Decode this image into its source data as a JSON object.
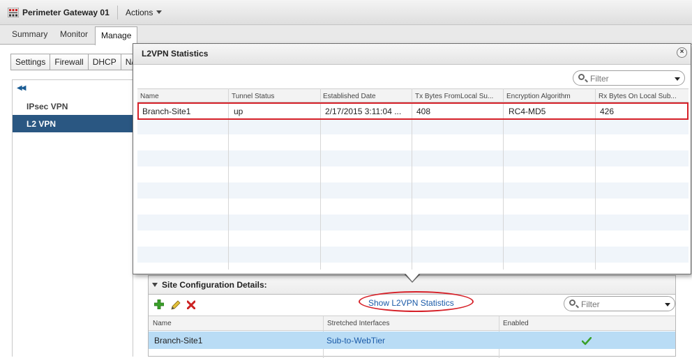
{
  "header": {
    "title": "Perimeter Gateway 01",
    "actions_label": "Actions"
  },
  "main_tabs": [
    {
      "label": "Summary"
    },
    {
      "label": "Monitor"
    },
    {
      "label": "Manage",
      "active": true
    }
  ],
  "sub_tabs": [
    {
      "label": "Settings"
    },
    {
      "label": "Firewall"
    },
    {
      "label": "DHCP"
    },
    {
      "label": "N/"
    }
  ],
  "left_nav": {
    "items": [
      {
        "label": "IPsec VPN",
        "selected": false
      },
      {
        "label": "L2 VPN",
        "selected": true
      }
    ]
  },
  "dialog": {
    "title": "L2VPN Statistics",
    "filter_placeholder": "Filter",
    "columns": [
      "Name",
      "Tunnel Status",
      "Established Date",
      "Tx Bytes FromLocal Su...",
      "Encryption Algorithm",
      "Rx Bytes On Local Sub..."
    ],
    "rows": [
      {
        "name": "Branch-Site1",
        "tunnel_status": "up",
        "established_date": "2/17/2015 3:11:04 ...",
        "tx_bytes": "408",
        "encryption": "RC4-MD5",
        "rx_bytes": "426"
      }
    ]
  },
  "site_config": {
    "title": "Site Configuration Details:",
    "show_stats_link": "Show L2VPN Statistics",
    "filter_placeholder": "Filter",
    "columns": [
      "Name",
      "Stretched Interfaces",
      "Enabled"
    ],
    "rows": [
      {
        "name": "Branch-Site1",
        "stretched_interfaces": "Sub-to-WebTier",
        "enabled": true
      }
    ]
  },
  "colors": {
    "selection_nav": "#2a5782",
    "selected_row": "#b9dcf5",
    "annotation_red": "#d62028",
    "link_blue": "#1a5aa8",
    "check_green": "#3aa02a",
    "add_green": "#3aa02a",
    "delete_red": "#cc2222"
  },
  "icons": [
    "app-icon",
    "chevron-down-icon",
    "collapse-left-icon",
    "close-icon",
    "search-icon",
    "add-icon",
    "edit-icon",
    "delete-icon",
    "check-icon"
  ]
}
